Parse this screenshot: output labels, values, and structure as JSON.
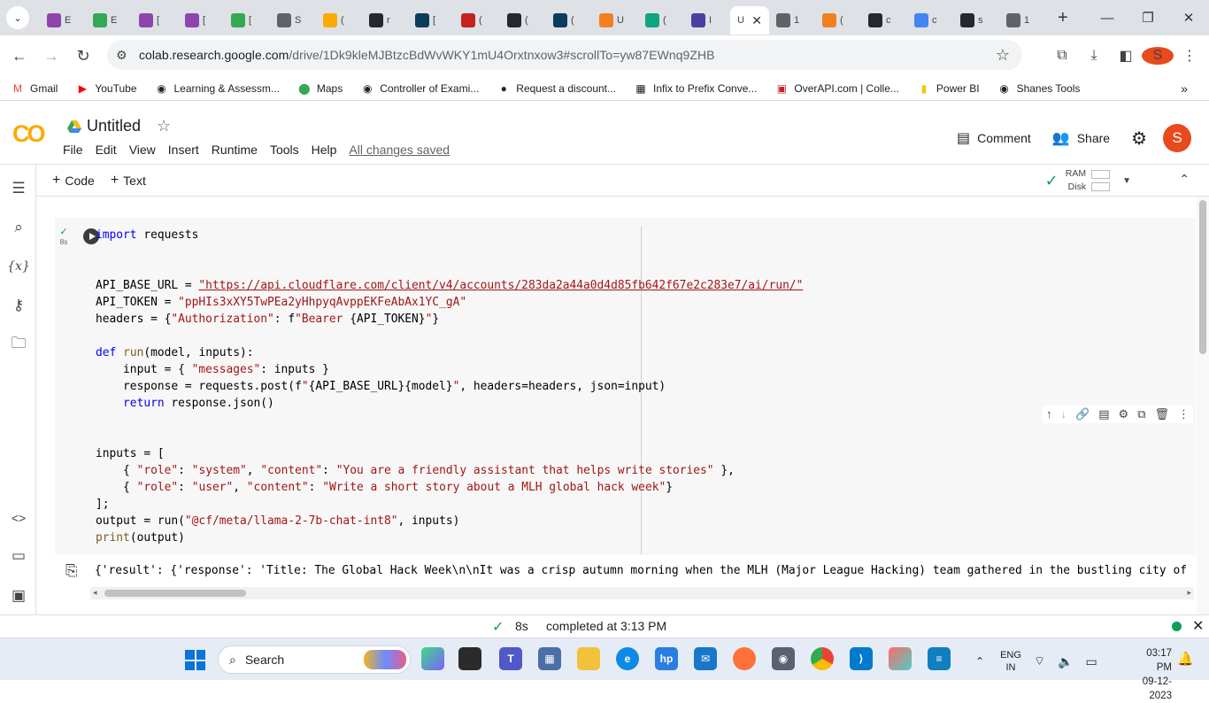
{
  "browser": {
    "tabs": [
      {
        "fav": "E",
        "color": "#8e44ad"
      },
      {
        "fav": "E",
        "color": "#34a853"
      },
      {
        "fav": "[",
        "color": "#8e44ad"
      },
      {
        "fav": "[",
        "color": "#8e44ad"
      },
      {
        "fav": "[",
        "color": "#34a853"
      },
      {
        "fav": "S",
        "color": "#5f6368"
      },
      {
        "fav": "(",
        "color": "#f9ab00"
      },
      {
        "fav": "r",
        "color": "#24292f"
      },
      {
        "fav": "[",
        "color": "#0b3c5d"
      },
      {
        "fav": "(",
        "color": "#c5221f"
      },
      {
        "fav": "(",
        "color": "#24292f"
      },
      {
        "fav": "(",
        "color": "#0b3c5d"
      },
      {
        "fav": "U",
        "color": "#f38020"
      },
      {
        "fav": "(",
        "color": "#10a37f"
      },
      {
        "fav": "I",
        "color": "#4b3fa0"
      }
    ],
    "active_tab": "U",
    "tabs_after": [
      {
        "fav": "1",
        "color": "#5f6368"
      },
      {
        "fav": "(",
        "color": "#f38020"
      },
      {
        "fav": "c",
        "color": "#24292f"
      },
      {
        "fav": "c",
        "color": "#4285f4"
      },
      {
        "fav": "s",
        "color": "#24292f"
      },
      {
        "fav": "1",
        "color": "#5f6368"
      }
    ],
    "url_host": "colab.research.google.com",
    "url_path": "/drive/1Dk9kleMJBtzcBdWvWKY1mU4Orxtnxow3#scrollTo=yw87EWnq9ZHB",
    "profile_initial": "S",
    "bookmarks": [
      {
        "label": "Gmail",
        "icon": "M",
        "color": "#ea4335"
      },
      {
        "label": "YouTube",
        "icon": "▶",
        "color": "#ff0000"
      },
      {
        "label": "Learning & Assessm...",
        "icon": "◉",
        "color": "#202124"
      },
      {
        "label": "Maps",
        "icon": "⬤",
        "color": "#34a853"
      },
      {
        "label": "Controller of Exami...",
        "icon": "◉",
        "color": "#202124"
      },
      {
        "label": "Request a discount...",
        "icon": "●",
        "color": "#24292f"
      },
      {
        "label": "Infix to Prefix Conve...",
        "icon": "▦",
        "color": "#202124"
      },
      {
        "label": "OverAPI.com | Colle...",
        "icon": "▣",
        "color": "#c5221f"
      },
      {
        "label": "Power BI",
        "icon": "▮",
        "color": "#f2c811"
      },
      {
        "label": "Shanes Tools",
        "icon": "◉",
        "color": "#202124"
      }
    ]
  },
  "colab": {
    "logo": "CO",
    "title": "Untitled",
    "menu": [
      "File",
      "Edit",
      "View",
      "Insert",
      "Runtime",
      "Tools",
      "Help"
    ],
    "saved_status": "All changes saved",
    "comment_label": "Comment",
    "share_label": "Share",
    "avatar_initial": "S",
    "add_code": "Code",
    "add_text": "Text",
    "ram_label": "RAM",
    "disk_label": "Disk",
    "exec_time": "8s",
    "output_text": "{'result': {'response': 'Title: The Global Hack Week\\n\\nIt was a crisp autumn morning when the MLH (Major League Hacking) team gathered in the bustling city of Sa",
    "status_time": "8s",
    "status_text": "completed at 3:13 PM"
  },
  "taskbar": {
    "search_label": "Search",
    "lang": "ENG",
    "region": "IN",
    "time": "03:17 PM",
    "date": "09-12-2023"
  }
}
